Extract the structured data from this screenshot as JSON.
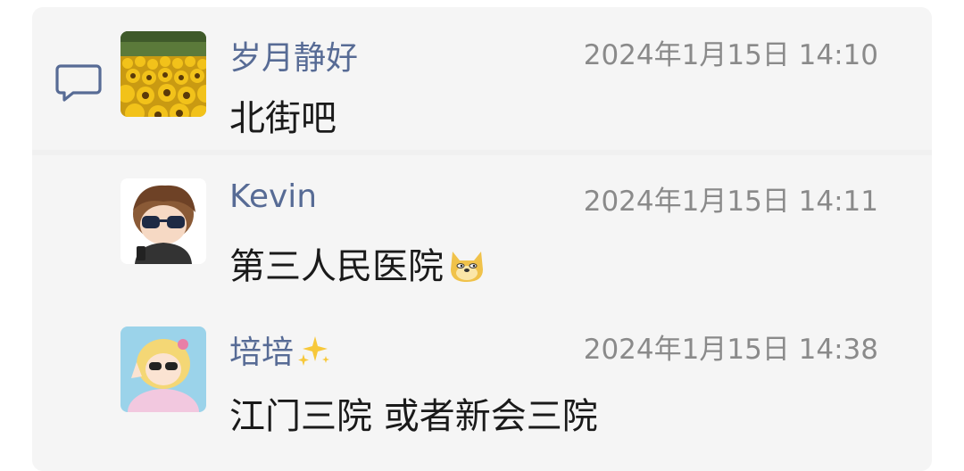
{
  "comments": [
    {
      "author": "岁月静好",
      "time": "2024年1月15日 14:10",
      "text": "北街吧",
      "avatar": "sunflower-field-avatar"
    },
    {
      "author": "Kevin",
      "time": "2024年1月15日 14:11",
      "text": "第三人民医院",
      "avatar": "cartoon-boy-sunglasses-avatar",
      "emoji": "doge-emoji"
    },
    {
      "author": "培培",
      "time": "2024年1月15日 14:38",
      "text": "江门三院 或者新会三院",
      "avatar": "cartoon-girl-sunglasses-avatar",
      "emoji": "sparkles-emoji"
    }
  ],
  "colors": {
    "author": "#576b95",
    "time": "#8a8a8a",
    "text": "#1a1a1a",
    "panel": "#f5f5f5"
  }
}
